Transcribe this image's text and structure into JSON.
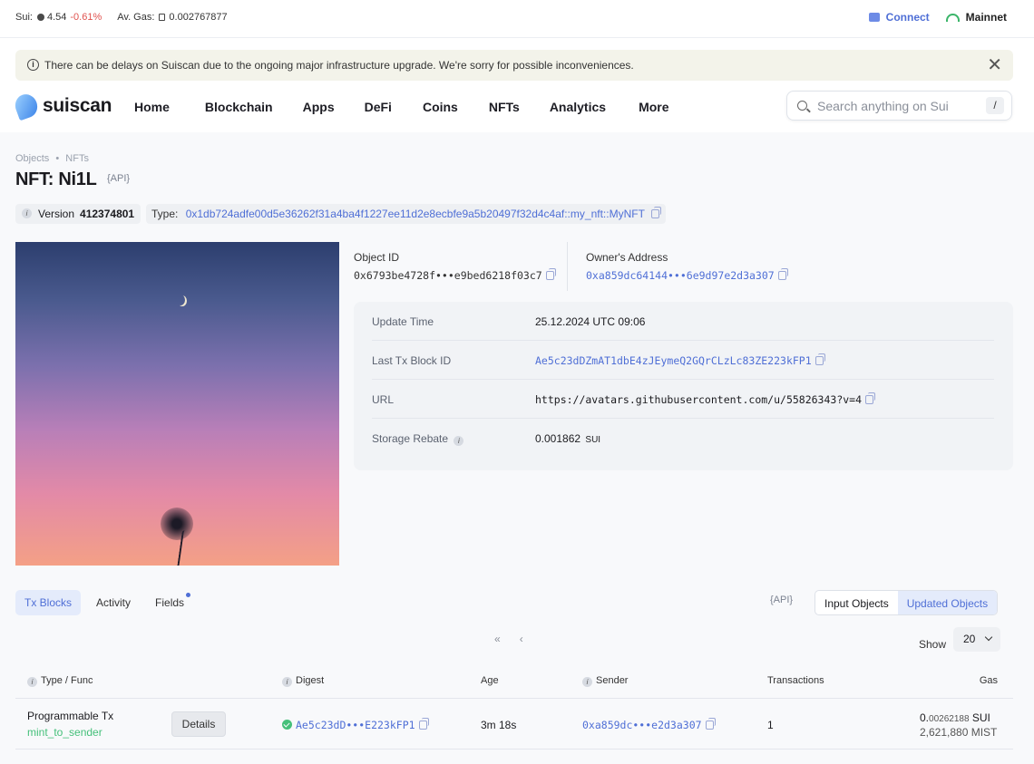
{
  "topbar": {
    "sui_label": "Sui:",
    "sui_price": "4.54",
    "sui_change": "-0.61%",
    "gas_label": "Av. Gas:",
    "gas_value": "0.002767877",
    "connect_label": "Connect",
    "network_label": "Mainnet"
  },
  "banner": {
    "message": "There can be delays on Suiscan due to the ongoing major infrastructure upgrade. We're sorry for possible inconveniences.",
    "close_symbol": "✕"
  },
  "nav": {
    "logo_text": "suiscan",
    "items": [
      "Home",
      "Blockchain",
      "Apps",
      "DeFi",
      "Coins",
      "NFTs",
      "Analytics",
      "More"
    ],
    "search_placeholder": "Search anything on Sui",
    "search_shortcut": "/"
  },
  "page": {
    "breadcrumb": [
      "Objects",
      "NFTs"
    ],
    "breadcrumb_sep": "•",
    "title": "NFT: Ni1L",
    "api_label": "{API}",
    "version_label": "Version",
    "version_value": "412374801",
    "type_label": "Type:",
    "type_value": "0x1db724adfe00d5e36262f31a4ba4f1227ee11d2e8ecbfe9a5b20497f32d4c4af::my_nft::MyNFT"
  },
  "object": {
    "object_id_label": "Object ID",
    "object_id_value": "0x6793be4728f•••e9bed6218f03c7",
    "owner_label": "Owner's Address",
    "owner_value": "0xa859dc64144•••6e9d97e2d3a307"
  },
  "details": [
    {
      "key": "Update Time",
      "value": "25.12.2024 UTC 09:06"
    },
    {
      "key": "Last Tx Block ID",
      "value": "Ae5c23dDZmAT1dbE4zJEymeQ2GQrCLzLc83ZE223kFP1"
    },
    {
      "key": "URL",
      "value": "https://avatars.githubusercontent.com/u/55826343?v=4"
    },
    {
      "key": "Storage Rebate",
      "value": "0.001862",
      "unit": "SUI"
    }
  ],
  "tabs": [
    "Tx Blocks",
    "Activity",
    "Fields"
  ],
  "api_label_right": "{API}",
  "toggle": [
    "Input Objects",
    "Updated Objects"
  ],
  "pager": {
    "first": "«",
    "prev": "‹"
  },
  "show": {
    "label": "Show",
    "value": "20"
  },
  "table": {
    "headers": [
      "Type / Func",
      "Digest",
      "Age",
      "Sender",
      "Transactions",
      "Gas"
    ],
    "rows": [
      {
        "type": "Programmable Tx",
        "func": "mint_to_sender",
        "details_label": "Details",
        "digest": "Ae5c23dD•••E223kFP1",
        "age": "3m 18s",
        "sender": "0xa859dc•••e2d3a307",
        "transactions": "1",
        "gas_int": "0.",
        "gas_frac": "00262188",
        "gas_unit": "SUI",
        "gas_mist": "2,621,880 MIST"
      }
    ]
  },
  "colors": {
    "accent": "#4f6fd6",
    "negative": "#e0524e",
    "success": "#45c07a",
    "func_green": "#45c07a"
  }
}
